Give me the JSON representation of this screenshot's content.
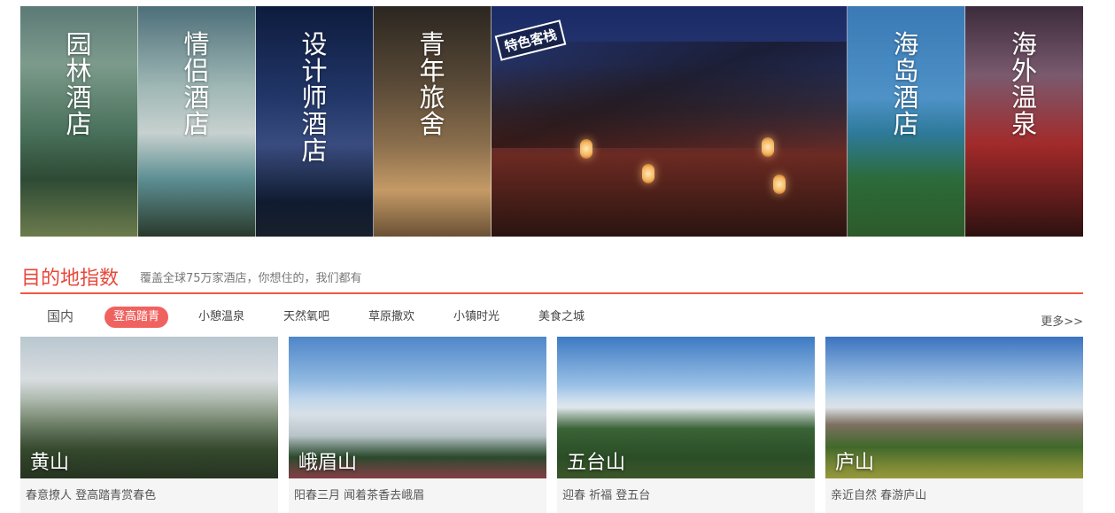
{
  "banner": {
    "panels": [
      {
        "label": "园林酒店"
      },
      {
        "label": "情侣酒店"
      },
      {
        "label": "设计师酒店"
      },
      {
        "label": "青年旅舍"
      },
      {
        "label": "",
        "stamp": "特色客栈"
      },
      {
        "label": "海岛酒店"
      },
      {
        "label": "海外温泉"
      }
    ]
  },
  "section": {
    "title": "目的地指数",
    "subtitle": "覆盖全球75万家酒店，你想住的，我们都有"
  },
  "tabs": {
    "region": "国内",
    "items": [
      {
        "label": "登高踏青",
        "active": true
      },
      {
        "label": "小憩温泉",
        "active": false
      },
      {
        "label": "天然氧吧",
        "active": false
      },
      {
        "label": "草原撒欢",
        "active": false
      },
      {
        "label": "小镇时光",
        "active": false
      },
      {
        "label": "美食之城",
        "active": false
      }
    ],
    "more": "更多>>"
  },
  "cards": [
    {
      "name": "黄山",
      "caption": "春意撩人 登高踏青赏春色"
    },
    {
      "name": "峨眉山",
      "caption": "阳春三月 闻着茶香去峨眉"
    },
    {
      "name": "五台山",
      "caption": "迎春 祈福 登五台"
    },
    {
      "name": "庐山",
      "caption": "亲近自然 春游庐山"
    }
  ],
  "colors": {
    "accent": "#e8483b",
    "active_tab": "#f0625f"
  }
}
